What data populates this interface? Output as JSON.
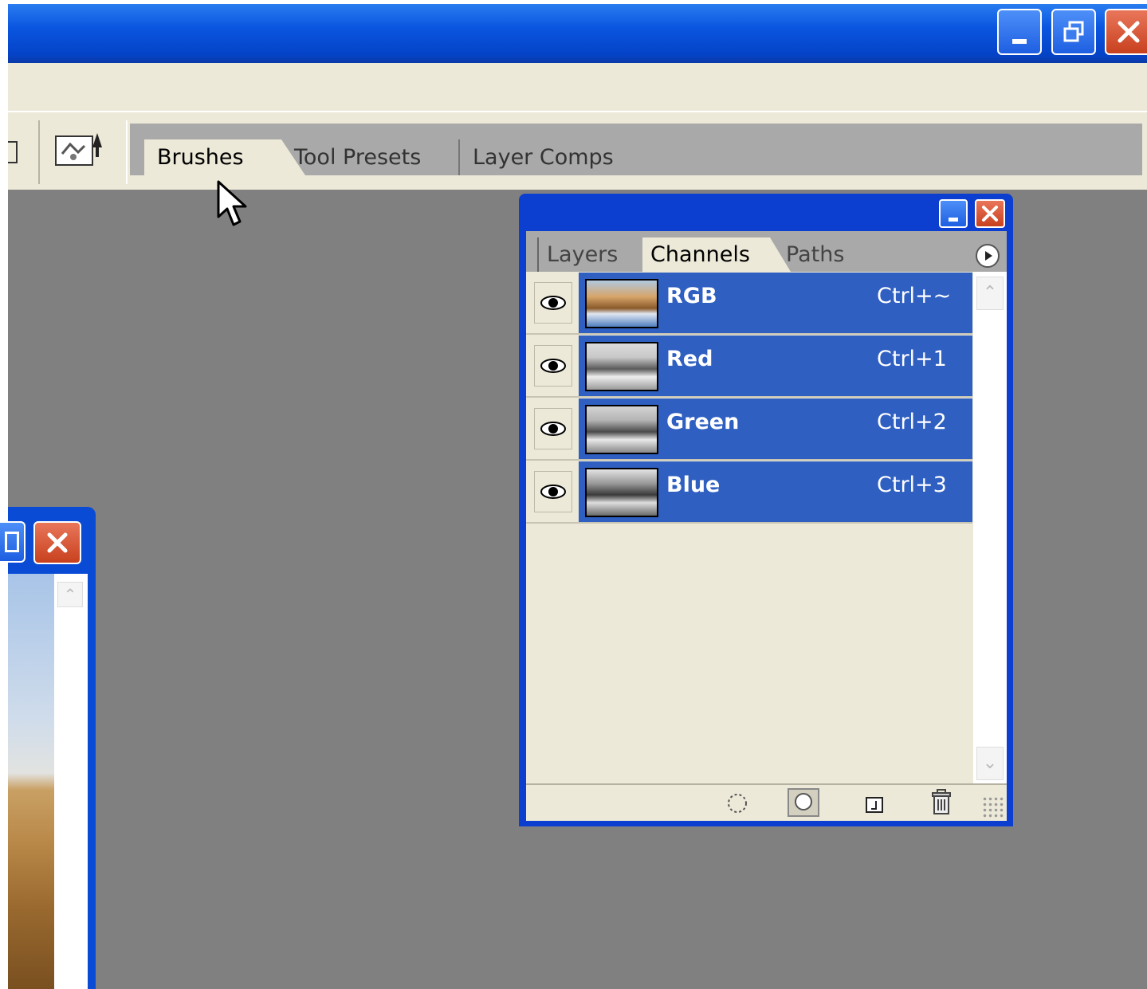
{
  "app": {
    "palette_well_tabs": [
      "Brushes",
      "Tool Presets",
      "Layer Comps"
    ]
  },
  "channels_palette": {
    "tabs": [
      "Layers",
      "Channels",
      "Paths"
    ],
    "active_tab": "Channels",
    "channels": [
      {
        "name": "RGB",
        "shortcut": "Ctrl+~",
        "visible": true,
        "selected": true,
        "thumb": "color"
      },
      {
        "name": "Red",
        "shortcut": "Ctrl+1",
        "visible": true,
        "selected": true,
        "thumb": "gray"
      },
      {
        "name": "Green",
        "shortcut": "Ctrl+2",
        "visible": true,
        "selected": true,
        "thumb": "gray"
      },
      {
        "name": "Blue",
        "shortcut": "Ctrl+3",
        "visible": true,
        "selected": true,
        "thumb": "gray"
      }
    ],
    "bottom_buttons": [
      "load-selection-icon",
      "save-selection-icon",
      "new-channel-icon",
      "trash-icon"
    ]
  },
  "colors": {
    "titlebar_blue": "#0a56e0",
    "selection_blue": "#2f5fc1",
    "panel_bg": "#ece9d8",
    "workspace_gray": "#808080",
    "close_red": "#c8411e"
  }
}
